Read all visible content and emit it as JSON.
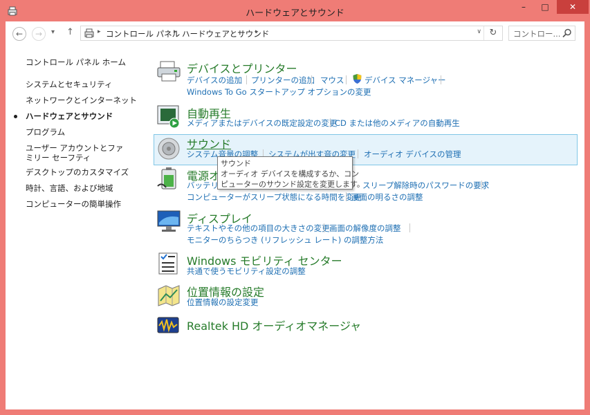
{
  "window": {
    "title": "ハードウェアとサウンド",
    "min": "–",
    "max": "□",
    "close": "✕"
  },
  "nav": {
    "back": "←",
    "forward": "→",
    "recent": "▾",
    "up": "↑",
    "breadcrumbs": [
      "コントロール パネル",
      "ハードウェアとサウンド"
    ],
    "separator": "▸",
    "dropdown": "∨",
    "refresh": "↻",
    "search_placeholder": "コントロー..."
  },
  "sidebar": {
    "items": [
      {
        "label": "コントロール パネル ホーム"
      },
      {
        "label": "システムとセキュリティ"
      },
      {
        "label": "ネットワークとインターネット"
      },
      {
        "label": "ハードウェアとサウンド",
        "current": true
      },
      {
        "label": "プログラム"
      },
      {
        "label": "ユーザー アカウントとファミリー セーフティ"
      },
      {
        "label": "デスクトップのカスタマイズ"
      },
      {
        "label": "時計、言語、および地域"
      },
      {
        "label": "コンピューターの簡単操作"
      }
    ]
  },
  "categories": [
    {
      "title": "デバイスとプリンター",
      "icon": "printer-icon",
      "links": [
        "デバイスの追加",
        "プリンターの追加",
        "マウス",
        "デバイス マネージャー",
        "Windows To Go スタートアップ オプションの変更"
      ]
    },
    {
      "title": "自動再生",
      "icon": "autoplay-icon",
      "links": [
        "メディアまたはデバイスの既定設定の変更",
        "CD または他のメディアの自動再生"
      ]
    },
    {
      "title": "サウンド",
      "icon": "speaker-icon",
      "links": [
        "システム音量の調整",
        "システムが出す音の変更",
        "オーディオ デバイスの管理"
      ]
    },
    {
      "title": "電源オ",
      "icon": "battery-icon",
      "links": [
        "バッテリ設",
        "スリープ解除時のパスワードの要求",
        "コンピューターがスリープ状態になる時間を変更",
        "画面の明るさの調整"
      ]
    },
    {
      "title": "ディスプレイ",
      "icon": "monitor-icon",
      "links": [
        "テキストやその他の項目の大きさの変更",
        "画面の解像度の調整",
        "モニターのちらつき (リフレッシュ レート) の調整方法"
      ]
    },
    {
      "title": "Windows モビリティ センター",
      "icon": "mobility-center-icon",
      "links": [
        "共通で使うモビリティ設定の調整"
      ]
    },
    {
      "title": "位置情報の設定",
      "icon": "location-icon",
      "links": [
        "位置情報の設定変更"
      ]
    },
    {
      "title": "Realtek HD オーディオマネージャ",
      "icon": "realtek-audio-icon",
      "links": []
    }
  ],
  "tooltip": {
    "title": "サウンド",
    "line1": "オーディオ デバイスを構成するか、コン",
    "line2": "ピューターのサウンド設定を変更します。"
  },
  "colors": {
    "frame": "#ef7c76",
    "close": "#c9403d",
    "category_title": "#267b2a",
    "link": "#1e6fb3",
    "highlight": "#e5f3fb"
  }
}
